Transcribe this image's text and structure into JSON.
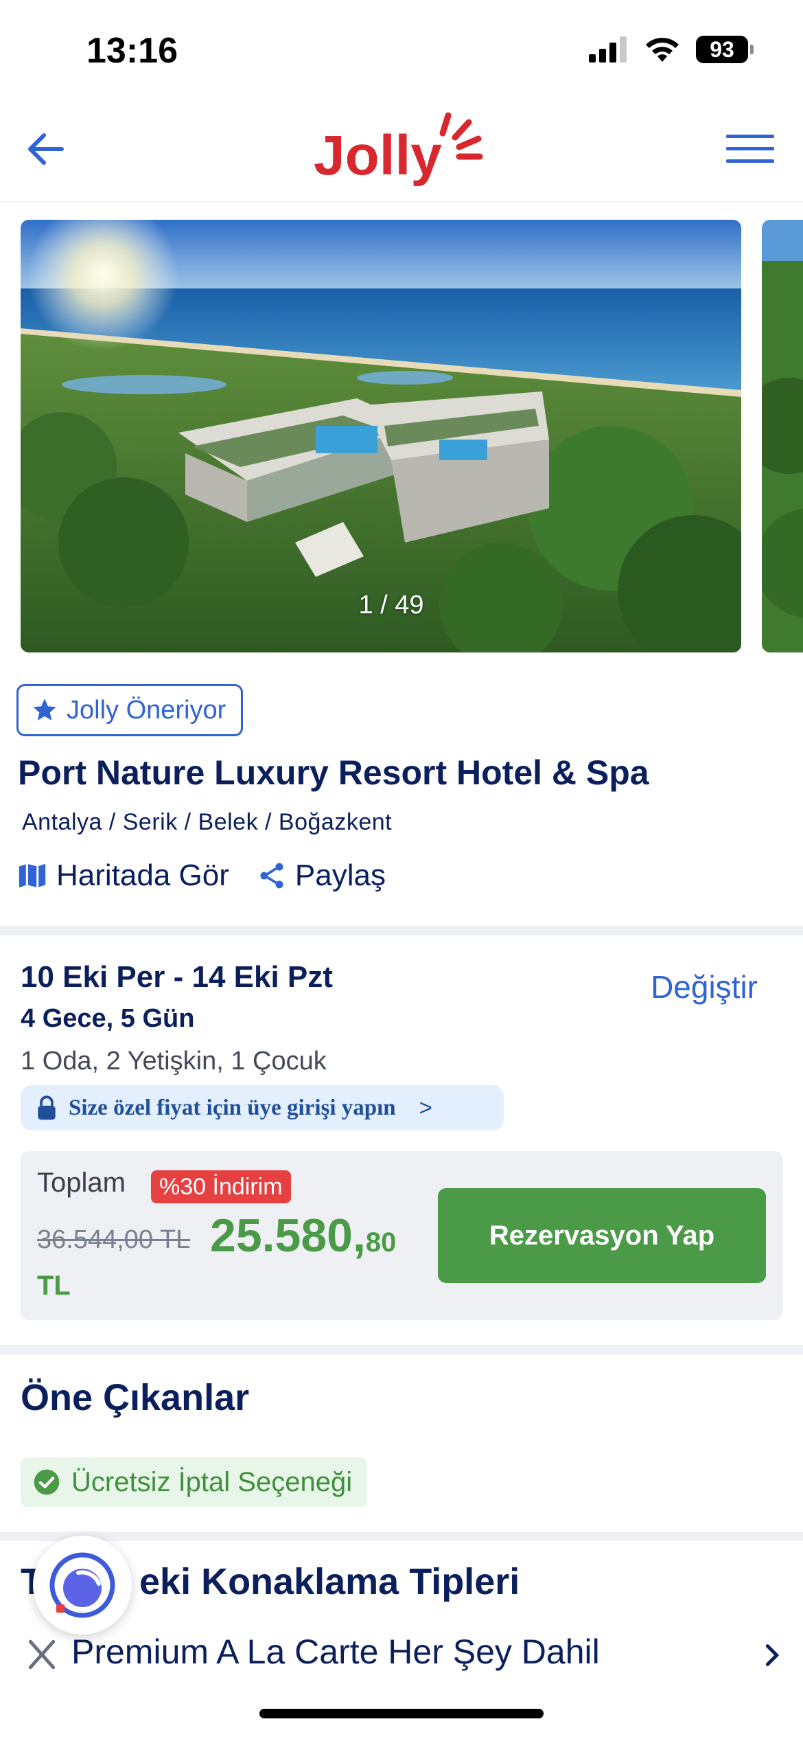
{
  "status": {
    "time": "13:16",
    "battery": "93"
  },
  "header": {
    "logo_text": "Jolly"
  },
  "gallery": {
    "counter": "1 / 49"
  },
  "hotel": {
    "badge": "Jolly Öneriyor",
    "name": "Port Nature Luxury Resort Hotel & Spa",
    "location": "Antalya / Serik / Belek / Boğazkent",
    "map_label": "Haritada Gör",
    "share_label": "Paylaş"
  },
  "booking": {
    "dates": "10 Eki Per - 14 Eki Pzt",
    "nights": "4 Gece, 5 Gün",
    "guests": "1 Oda, 2 Yetişkin, 1 Çocuk",
    "change_label": "Değiştir",
    "member_prompt": "Size özel fiyat için üye girişi yapın",
    "member_chevron": ">"
  },
  "price": {
    "total_label": "Toplam",
    "discount": "%30 İndirim",
    "old_price": "36.544,00 TL",
    "new_price_main": "25.580,",
    "new_price_cents": "80",
    "currency": "TL",
    "reserve_label": "Rezervasyon Yap"
  },
  "highlights": {
    "title": "Öne Çıkanlar",
    "items": [
      "Ücretsiz İptal Seçeneği"
    ]
  },
  "accommodation": {
    "title_visible": "T",
    "title_rest": "eki Konaklama Tipleri",
    "first_item": "Premium A La Carte Her Şey Dahil"
  },
  "colors": {
    "brand_red": "#d9272e",
    "primary_blue": "#2f63d6",
    "navy": "#0b1f5c",
    "green": "#4a9a47",
    "discount_red": "#e64040"
  },
  "icons": [
    "signal-icon",
    "wifi-icon",
    "battery-icon",
    "back-arrow-icon",
    "hamburger-menu-icon",
    "star-icon",
    "map-icon",
    "share-icon",
    "lock-icon",
    "check-circle-icon",
    "chat-support-icon",
    "cutlery-icon",
    "chevron-right-icon"
  ]
}
